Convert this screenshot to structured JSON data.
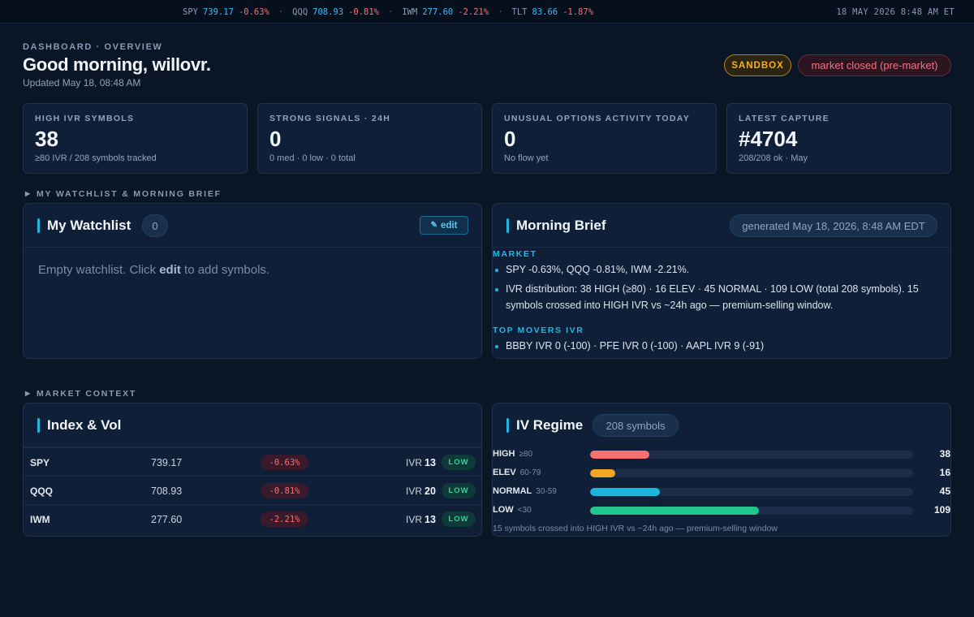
{
  "ticker": {
    "items": [
      {
        "symbol": "SPY",
        "price": "739.17",
        "change": "-0.63%"
      },
      {
        "symbol": "QQQ",
        "price": "708.93",
        "change": "-0.81%"
      },
      {
        "symbol": "IWM",
        "price": "277.60",
        "change": "-2.21%"
      },
      {
        "symbol": "TLT",
        "price": "83.66",
        "change": "-1.87%"
      }
    ],
    "separator": "·",
    "timestamp": "18 MAY 2026 8:48 AM ET"
  },
  "header": {
    "breadcrumb": "DASHBOARD · OVERVIEW",
    "greeting": "Good morning, willovr.",
    "updated": "Updated May 18, 08:48 AM",
    "badges": {
      "sandbox": "SANDBOX",
      "market": "market closed (pre-market)"
    }
  },
  "stats": [
    {
      "label": "HIGH IVR SYMBOLS",
      "value": "38",
      "sub": "≥80 IVR / 208 symbols tracked"
    },
    {
      "label": "STRONG SIGNALS · 24H",
      "value": "0",
      "sub": "0 med · 0 low · 0 total"
    },
    {
      "label": "UNUSUAL OPTIONS ACTIVITY TODAY",
      "value": "0",
      "sub": "No flow yet"
    },
    {
      "label": "LATEST CAPTURE",
      "value": "#4704",
      "sub": "208/208 ok · May"
    }
  ],
  "sections": {
    "watchlist_brief": "MY WATCHLIST & MORNING BRIEF",
    "market_context": "MARKET CONTEXT",
    "caret": "▶"
  },
  "watchlist": {
    "title": "My Watchlist",
    "count": "0",
    "edit_icon": "✎",
    "edit_label": "edit",
    "empty_before": "Empty watchlist. Click ",
    "empty_link": "edit",
    "empty_after": " to add symbols."
  },
  "brief": {
    "title": "Morning Brief",
    "generated": "generated May 18, 2026, 8:48 AM EDT",
    "market_heading": "MARKET",
    "market_items": [
      "SPY -0.63%, QQQ -0.81%, IWM -2.21%.",
      "IVR distribution: 38 HIGH (≥80) · 16 ELEV · 45 NORMAL · 109 LOW (total 208 symbols). 15 symbols crossed into HIGH IVR vs ~24h ago — premium-selling window."
    ],
    "movers_heading": "TOP MOVERS IVR",
    "movers_items": [
      "BBBY IVR 0 (-100) · PFE IVR 0 (-100) · AAPL IVR 9 (-91)"
    ]
  },
  "index_vol": {
    "title": "Index & Vol",
    "ivr_label": "IVR",
    "rows": [
      {
        "symbol": "SPY",
        "price": "739.17",
        "change": "-0.63%",
        "ivr": "13",
        "tag": "LOW"
      },
      {
        "symbol": "QQQ",
        "price": "708.93",
        "change": "-0.81%",
        "ivr": "20",
        "tag": "LOW"
      },
      {
        "symbol": "IWM",
        "price": "277.60",
        "change": "-2.21%",
        "ivr": "13",
        "tag": "LOW"
      }
    ]
  },
  "iv_regime": {
    "title": "IV Regime",
    "total": "208 symbols",
    "total_count": 208,
    "rows": [
      {
        "name": "HIGH",
        "range": "≥80",
        "count": "38",
        "value": 38,
        "color": "#f87171"
      },
      {
        "name": "ELEV",
        "range": "60-79",
        "count": "16",
        "value": 16,
        "color": "#f5a623"
      },
      {
        "name": "NORMAL",
        "range": "30-59",
        "count": "45",
        "value": 45,
        "color": "#1eb5dc"
      },
      {
        "name": "LOW",
        "range": "<30",
        "count": "109",
        "value": 109,
        "color": "#22c58b"
      }
    ],
    "footnote": "15 symbols crossed into HIGH IVR vs ~24h ago — premium-selling window"
  },
  "colors": {
    "accent": "#22b6e0",
    "negative": "#f87171",
    "positive": "#34d399",
    "warning": "#f5b021",
    "background": "#0a1525",
    "panel": "#0f1f38"
  }
}
